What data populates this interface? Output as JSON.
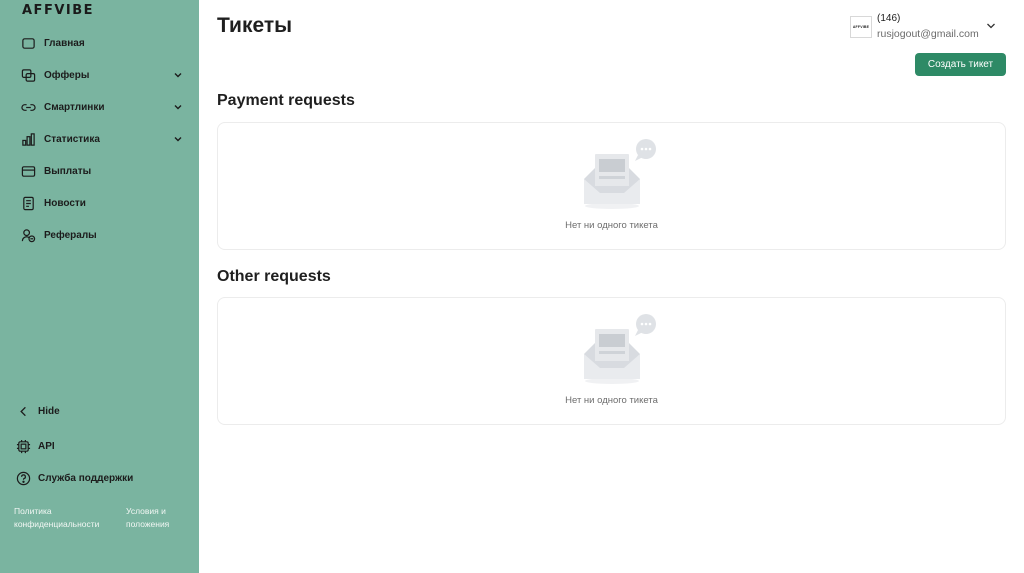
{
  "sidebar": {
    "logo": "AFFVIBE",
    "items": [
      {
        "label": "Главная",
        "icon": "home-icon"
      },
      {
        "label": "Офферы",
        "icon": "offers-icon",
        "has_chevron": true
      },
      {
        "label": "Смартлинки",
        "icon": "link-icon",
        "has_chevron": true
      },
      {
        "label": "Статистика",
        "icon": "chart-icon",
        "has_chevron": true
      },
      {
        "label": "Выплаты",
        "icon": "card-icon"
      },
      {
        "label": "Новости",
        "icon": "news-icon"
      },
      {
        "label": "Рефералы",
        "icon": "referrals-icon"
      }
    ],
    "hide_label": "Hide",
    "api_label": "API",
    "support_label": "Служба поддержки",
    "footer": {
      "policy_line1": "Политика",
      "policy_line2": "конфиденциальности",
      "terms_line1": "Условия и",
      "terms_line2": "положения"
    }
  },
  "header": {
    "title": "Тикеты",
    "user_count": "(146)",
    "user_email": "rusjogout@gmail.com",
    "avatar_text": "AFFVIBE",
    "create_button": "Создать тикет"
  },
  "sections": [
    {
      "title": "Payment requests",
      "empty_text": "Нет ни одного тикета"
    },
    {
      "title": "Other requests",
      "empty_text": "Нет ни одного тикета"
    }
  ],
  "colors": {
    "sidebar_bg": "#7ab4a0",
    "accent": "#2e8a66",
    "panel_border": "#ececec"
  }
}
